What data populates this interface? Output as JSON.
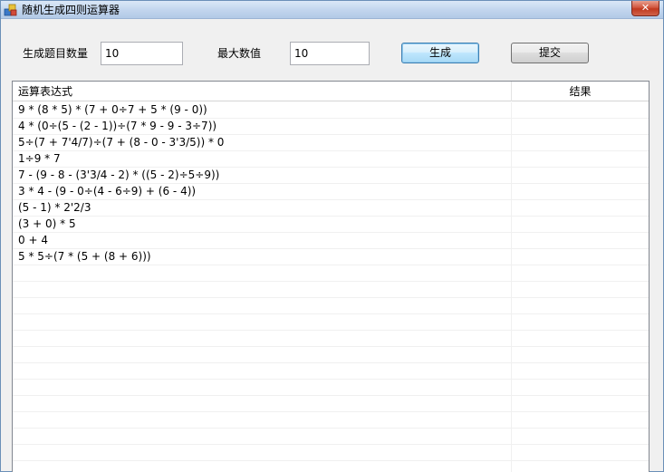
{
  "window": {
    "title": "随机生成四则运算器",
    "close_glyph": "✕"
  },
  "controls": {
    "count_label": "生成题目数量",
    "count_value": "10",
    "max_label": "最大数值",
    "max_value": "10",
    "generate_button": "生成",
    "submit_button": "提交"
  },
  "grid": {
    "columns": [
      "运算表达式",
      "结果"
    ],
    "rows": [
      {
        "expr": "9 * (8 * 5) * (7 + 0÷7 + 5 * (9 - 0))",
        "result": ""
      },
      {
        "expr": "4 * (0÷(5 - (2 - 1))÷(7 * 9 - 9 - 3÷7))",
        "result": ""
      },
      {
        "expr": "5÷(7 + 7'4/7)÷(7 + (8 - 0 - 3'3/5)) * 0",
        "result": ""
      },
      {
        "expr": "1÷9 * 7",
        "result": ""
      },
      {
        "expr": "7 - (9 - 8 - (3'3/4 - 2) * ((5 - 2)÷5÷9))",
        "result": ""
      },
      {
        "expr": "3 * 4 - (9 - 0÷(4 - 6÷9) + (6 - 4))",
        "result": ""
      },
      {
        "expr": "(5 - 1) * 2'2/3",
        "result": ""
      },
      {
        "expr": "(3 + 0) * 5",
        "result": ""
      },
      {
        "expr": "0 + 4",
        "result": ""
      },
      {
        "expr": "5 * 5÷(7 * (5 + (8 + 6)))",
        "result": ""
      },
      {
        "expr": "",
        "result": ""
      },
      {
        "expr": "",
        "result": ""
      },
      {
        "expr": "",
        "result": ""
      },
      {
        "expr": "",
        "result": ""
      },
      {
        "expr": "",
        "result": ""
      },
      {
        "expr": "",
        "result": ""
      },
      {
        "expr": "",
        "result": ""
      },
      {
        "expr": "",
        "result": ""
      },
      {
        "expr": "",
        "result": ""
      },
      {
        "expr": "",
        "result": ""
      },
      {
        "expr": "",
        "result": ""
      },
      {
        "expr": "",
        "result": ""
      },
      {
        "expr": "",
        "result": ""
      }
    ]
  }
}
